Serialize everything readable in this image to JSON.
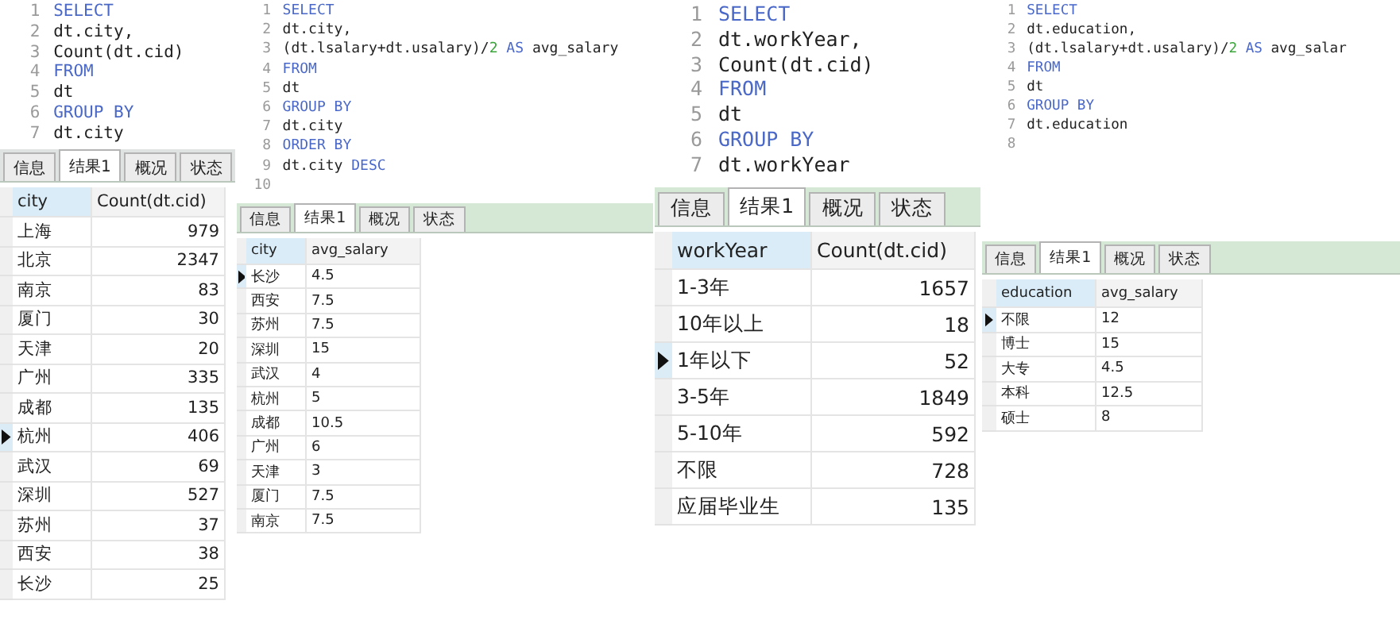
{
  "panels": [
    {
      "code": [
        {
          "number": "1",
          "segments": [
            {
              "text": "SELECT",
              "kind": "keyword"
            }
          ]
        },
        {
          "number": "2",
          "segments": [
            {
              "text": "dt.city,",
              "kind": "plain"
            }
          ]
        },
        {
          "number": "3",
          "segments": [
            {
              "text": "Count(dt.cid)",
              "kind": "plain"
            }
          ]
        },
        {
          "number": "4",
          "segments": [
            {
              "text": "FROM",
              "kind": "keyword"
            }
          ]
        },
        {
          "number": "5",
          "segments": [
            {
              "text": "dt",
              "kind": "plain"
            }
          ]
        },
        {
          "number": "6",
          "segments": [
            {
              "text": "GROUP BY",
              "kind": "keyword"
            }
          ]
        },
        {
          "number": "7",
          "segments": [
            {
              "text": "dt.city",
              "kind": "plain"
            }
          ]
        }
      ],
      "tabs": [
        {
          "label": "信息",
          "selected": false
        },
        {
          "label": "结果1",
          "selected": true
        },
        {
          "label": "概况",
          "selected": false
        },
        {
          "label": "状态",
          "selected": false
        }
      ],
      "columns": [
        {
          "label": "city"
        },
        {
          "label": "Count(dt.cid)"
        }
      ],
      "rows": [
        {
          "cells": [
            "上海",
            "979"
          ],
          "selected": false
        },
        {
          "cells": [
            "北京",
            "2347"
          ],
          "selected": false
        },
        {
          "cells": [
            "南京",
            "83"
          ],
          "selected": false
        },
        {
          "cells": [
            "厦门",
            "30"
          ],
          "selected": false
        },
        {
          "cells": [
            "天津",
            "20"
          ],
          "selected": false
        },
        {
          "cells": [
            "广州",
            "335"
          ],
          "selected": false
        },
        {
          "cells": [
            "成都",
            "135"
          ],
          "selected": false
        },
        {
          "cells": [
            "杭州",
            "406"
          ],
          "selected": true
        },
        {
          "cells": [
            "武汉",
            "69"
          ],
          "selected": false
        },
        {
          "cells": [
            "深圳",
            "527"
          ],
          "selected": false
        },
        {
          "cells": [
            "苏州",
            "37"
          ],
          "selected": false
        },
        {
          "cells": [
            "西安",
            "38"
          ],
          "selected": false
        },
        {
          "cells": [
            "长沙",
            "25"
          ],
          "selected": false
        }
      ]
    },
    {
      "code": [
        {
          "number": "1",
          "segments": [
            {
              "text": "SELECT",
              "kind": "keyword"
            }
          ]
        },
        {
          "number": "2",
          "segments": [
            {
              "text": "dt.city,",
              "kind": "plain"
            }
          ]
        },
        {
          "number": "3",
          "segments": [
            {
              "text": "(dt.lsalary+dt.usalary)/",
              "kind": "plain"
            },
            {
              "text": "2",
              "kind": "number"
            },
            {
              "text": " AS ",
              "kind": "keyword"
            },
            {
              "text": "avg_salary",
              "kind": "plain"
            }
          ]
        },
        {
          "number": "4",
          "segments": [
            {
              "text": "FROM",
              "kind": "keyword"
            }
          ]
        },
        {
          "number": "5",
          "segments": [
            {
              "text": "dt",
              "kind": "plain"
            }
          ]
        },
        {
          "number": "6",
          "segments": [
            {
              "text": "GROUP BY",
              "kind": "keyword"
            }
          ]
        },
        {
          "number": "7",
          "segments": [
            {
              "text": "dt.city",
              "kind": "plain"
            }
          ]
        },
        {
          "number": "8",
          "segments": [
            {
              "text": "ORDER BY",
              "kind": "keyword"
            }
          ]
        },
        {
          "number": "9",
          "segments": [
            {
              "text": "dt.city ",
              "kind": "plain"
            },
            {
              "text": "DESC",
              "kind": "keyword"
            }
          ]
        },
        {
          "number": "10"
        }
      ],
      "tabs": [
        {
          "label": "信息",
          "selected": false
        },
        {
          "label": "结果1",
          "selected": true
        },
        {
          "label": "概况",
          "selected": false
        },
        {
          "label": "状态",
          "selected": false
        }
      ],
      "columns": [
        {
          "label": "city"
        },
        {
          "label": "avg_salary"
        }
      ],
      "rows": [
        {
          "cells": [
            "长沙",
            "4.5"
          ],
          "selected": true
        },
        {
          "cells": [
            "西安",
            "7.5"
          ],
          "selected": false
        },
        {
          "cells": [
            "苏州",
            "7.5"
          ],
          "selected": false
        },
        {
          "cells": [
            "深圳",
            "15"
          ],
          "selected": false
        },
        {
          "cells": [
            "武汉",
            "4"
          ],
          "selected": false
        },
        {
          "cells": [
            "杭州",
            "5"
          ],
          "selected": false
        },
        {
          "cells": [
            "成都",
            "10.5"
          ],
          "selected": false
        },
        {
          "cells": [
            "广州",
            "6"
          ],
          "selected": false
        },
        {
          "cells": [
            "天津",
            "3"
          ],
          "selected": false
        },
        {
          "cells": [
            "厦门",
            "7.5"
          ],
          "selected": false
        },
        {
          "cells": [
            "南京",
            "7.5"
          ],
          "selected": false
        }
      ]
    },
    {
      "code": [
        {
          "number": "1",
          "segments": [
            {
              "text": "SELECT",
              "kind": "keyword"
            }
          ]
        },
        {
          "number": "2",
          "segments": [
            {
              "text": "dt.workYear,",
              "kind": "plain"
            }
          ]
        },
        {
          "number": "3",
          "segments": [
            {
              "text": "Count(dt.cid)",
              "kind": "plain"
            }
          ]
        },
        {
          "number": "4",
          "segments": [
            {
              "text": "FROM",
              "kind": "keyword"
            }
          ]
        },
        {
          "number": "5",
          "segments": [
            {
              "text": "dt",
              "kind": "plain"
            }
          ]
        },
        {
          "number": "6",
          "segments": [
            {
              "text": "GROUP BY",
              "kind": "keyword"
            }
          ]
        },
        {
          "number": "7",
          "segments": [
            {
              "text": "dt.workYear",
              "kind": "plain"
            }
          ]
        }
      ],
      "tabs": [
        {
          "label": "信息",
          "selected": false
        },
        {
          "label": "结果1",
          "selected": true
        },
        {
          "label": "概况",
          "selected": false
        },
        {
          "label": "状态",
          "selected": false
        }
      ],
      "columns": [
        {
          "label": "workYear"
        },
        {
          "label": "Count(dt.cid)"
        }
      ],
      "rows": [
        {
          "cells": [
            "1-3年",
            "1657"
          ],
          "selected": false
        },
        {
          "cells": [
            "10年以上",
            "18"
          ],
          "selected": false
        },
        {
          "cells": [
            "1年以下",
            "52"
          ],
          "selected": true
        },
        {
          "cells": [
            "3-5年",
            "1849"
          ],
          "selected": false
        },
        {
          "cells": [
            "5-10年",
            "592"
          ],
          "selected": false
        },
        {
          "cells": [
            "不限",
            "728"
          ],
          "selected": false
        },
        {
          "cells": [
            "应届毕业生",
            "135"
          ],
          "selected": false
        }
      ]
    },
    {
      "code": [
        {
          "number": "1",
          "segments": [
            {
              "text": "SELECT",
              "kind": "keyword"
            }
          ]
        },
        {
          "number": "2",
          "segments": [
            {
              "text": "dt.education,",
              "kind": "plain"
            }
          ]
        },
        {
          "number": "3",
          "segments": [
            {
              "text": "(dt.lsalary+dt.usalary)/",
              "kind": "plain"
            },
            {
              "text": "2",
              "kind": "number"
            },
            {
              "text": " AS ",
              "kind": "keyword"
            },
            {
              "text": "avg_salar",
              "kind": "plain"
            }
          ]
        },
        {
          "number": "4",
          "segments": [
            {
              "text": "FROM",
              "kind": "keyword"
            }
          ]
        },
        {
          "number": "5",
          "segments": [
            {
              "text": "dt",
              "kind": "plain"
            }
          ]
        },
        {
          "number": "6",
          "segments": [
            {
              "text": "GROUP BY",
              "kind": "keyword"
            }
          ]
        },
        {
          "number": "7",
          "segments": [
            {
              "text": "dt.education",
              "kind": "plain"
            }
          ]
        },
        {
          "number": "8"
        }
      ],
      "tabs": [
        {
          "label": "信息",
          "selected": false
        },
        {
          "label": "结果1",
          "selected": true
        },
        {
          "label": "概况",
          "selected": false
        },
        {
          "label": "状态",
          "selected": false
        }
      ],
      "columns": [
        {
          "label": "education"
        },
        {
          "label": "avg_salary"
        }
      ],
      "rows": [
        {
          "cells": [
            "不限",
            "12"
          ],
          "selected": true
        },
        {
          "cells": [
            "博士",
            "15"
          ],
          "selected": false
        },
        {
          "cells": [
            "大专",
            "4.5"
          ],
          "selected": false
        },
        {
          "cells": [
            "本科",
            "12.5"
          ],
          "selected": false
        },
        {
          "cells": [
            "硕士",
            "8"
          ],
          "selected": false
        }
      ]
    }
  ]
}
